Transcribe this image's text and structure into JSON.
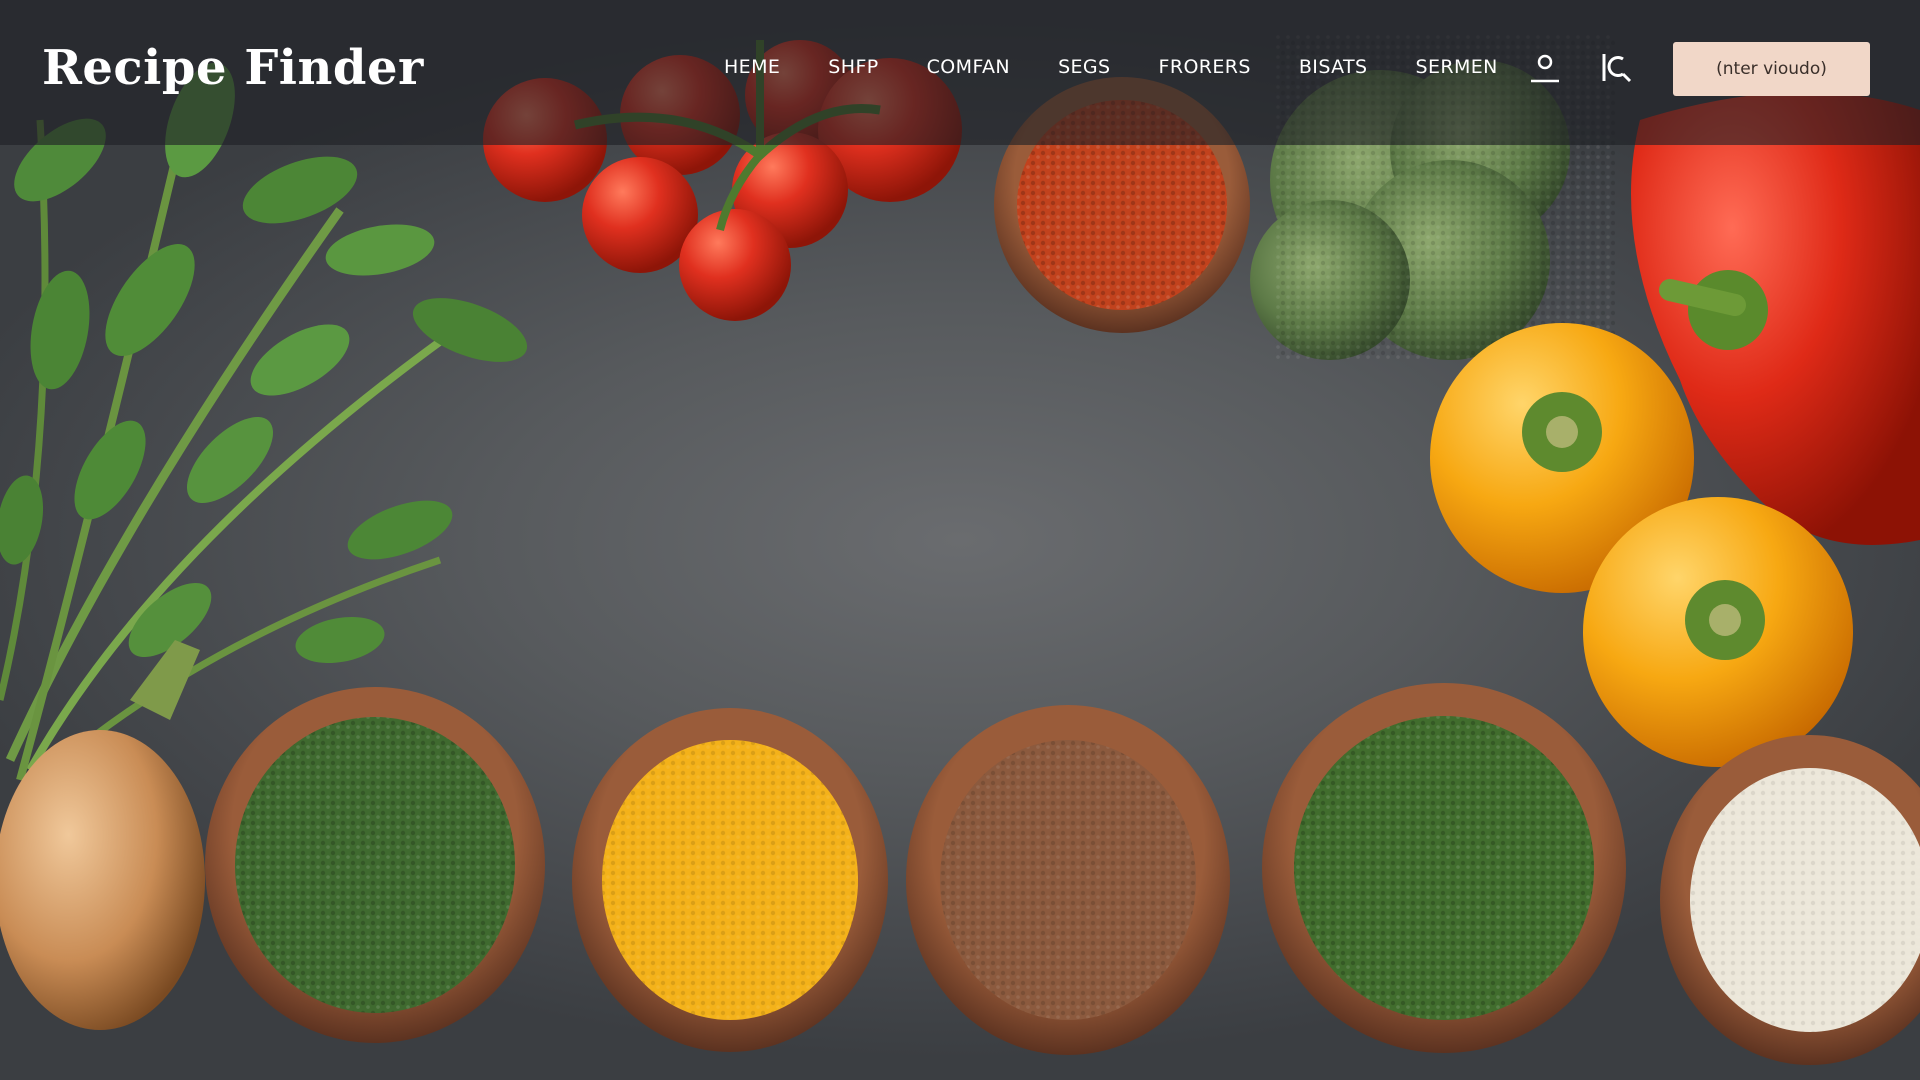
{
  "app": {
    "title": "Recipe Finder"
  },
  "nav": {
    "items": [
      {
        "label": "HEME"
      },
      {
        "label": "SHFP"
      },
      {
        "label": "COMFAN"
      },
      {
        "label": "SEGS"
      },
      {
        "label": "FRORERS"
      },
      {
        "label": "BISATS"
      },
      {
        "label": "SERMEN"
      }
    ]
  },
  "icons": {
    "account": "user-icon",
    "search": "search-icon"
  },
  "cta": {
    "label": "(nter vioudo)"
  },
  "colors": {
    "header_bg": "#1e2125",
    "cta_bg": "#f1d7c8",
    "text": "#ffffff"
  }
}
